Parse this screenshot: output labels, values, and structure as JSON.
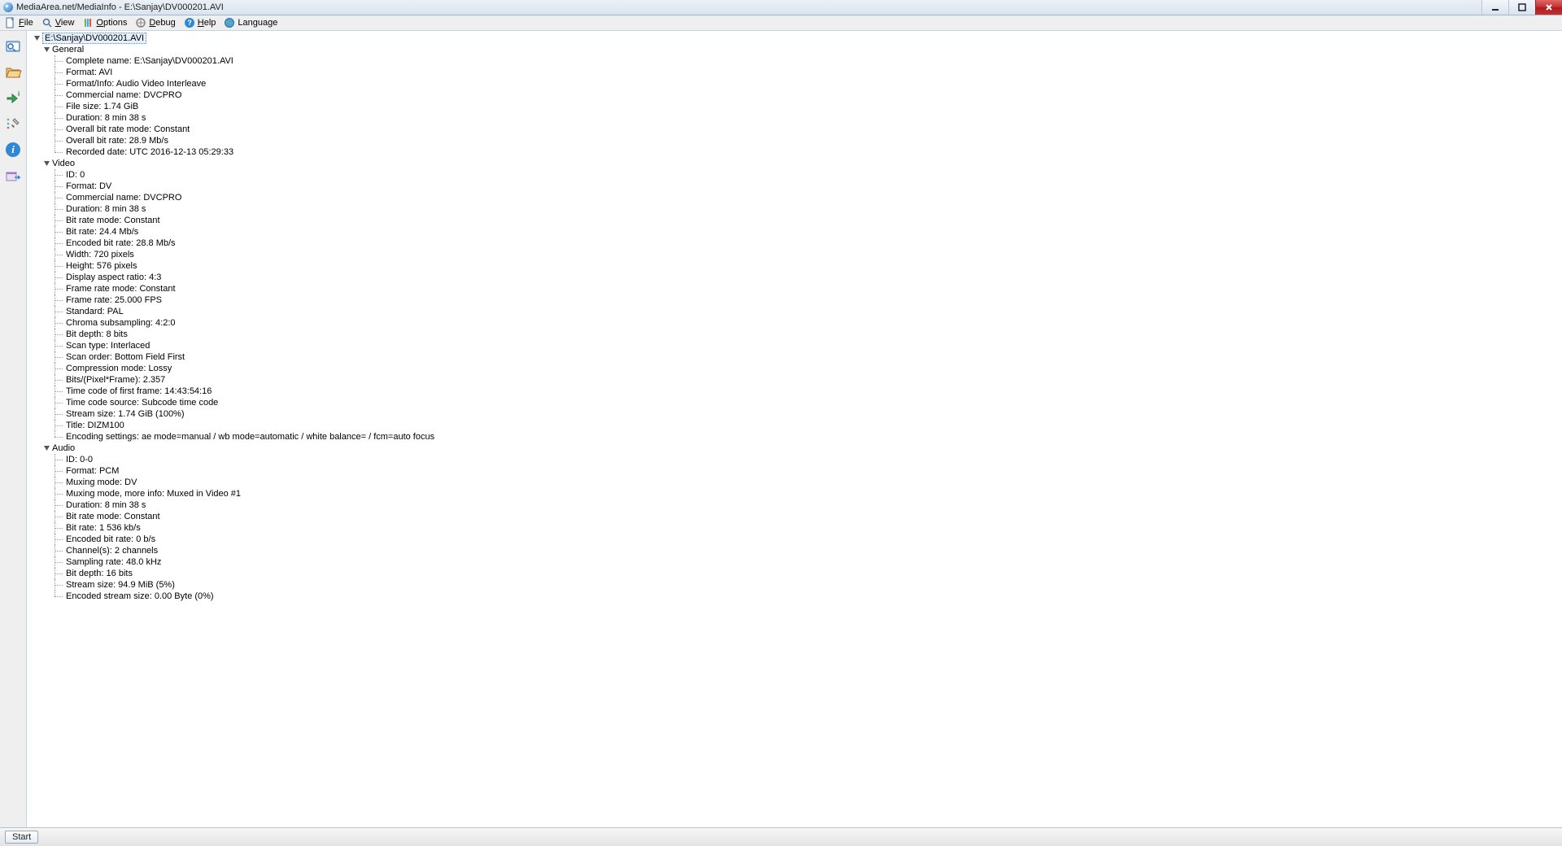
{
  "title": "MediaArea.net/MediaInfo - E:\\Sanjay\\DV000201.AVI",
  "menu": {
    "file": "File",
    "view": "View",
    "options": "Options",
    "debug": "Debug",
    "help": "Help",
    "language": "Language"
  },
  "taskbar": {
    "start": "Start"
  },
  "tree": {
    "root": "E:\\Sanjay\\DV000201.AVI",
    "general": {
      "label": "General",
      "items": [
        "Complete name: E:\\Sanjay\\DV000201.AVI",
        "Format: AVI",
        "Format/Info: Audio Video Interleave",
        "Commercial name: DVCPRO",
        "File size: 1.74 GiB",
        "Duration: 8 min 38 s",
        "Overall bit rate mode: Constant",
        "Overall bit rate: 28.9 Mb/s",
        "Recorded date: UTC 2016-12-13 05:29:33"
      ]
    },
    "video": {
      "label": "Video",
      "items": [
        "ID: 0",
        "Format: DV",
        "Commercial name: DVCPRO",
        "Duration: 8 min 38 s",
        "Bit rate mode: Constant",
        "Bit rate: 24.4 Mb/s",
        "Encoded bit rate: 28.8 Mb/s",
        "Width: 720 pixels",
        "Height: 576 pixels",
        "Display aspect ratio: 4:3",
        "Frame rate mode: Constant",
        "Frame rate: 25.000 FPS",
        "Standard: PAL",
        "Chroma subsampling: 4:2:0",
        "Bit depth: 8 bits",
        "Scan type: Interlaced",
        "Scan order: Bottom Field First",
        "Compression mode: Lossy",
        "Bits/(Pixel*Frame): 2.357",
        "Time code of first frame: 14:43:54:16",
        "Time code source: Subcode time code",
        "Stream size: 1.74 GiB (100%)",
        "Title: DIZM100",
        "Encoding settings: ae mode=manual / wb mode=automatic / white balance= / fcm=auto focus"
      ]
    },
    "audio": {
      "label": "Audio",
      "items": [
        "ID: 0-0",
        "Format: PCM",
        "Muxing mode: DV",
        "Muxing mode, more info: Muxed in Video #1",
        "Duration: 8 min 38 s",
        "Bit rate mode: Constant",
        "Bit rate: 1 536 kb/s",
        "Encoded bit rate: 0 b/s",
        "Channel(s): 2 channels",
        "Sampling rate: 48.0 kHz",
        "Bit depth: 16 bits",
        "Stream size: 94.9 MiB (5%)",
        "Encoded stream size: 0.00 Byte (0%)"
      ]
    }
  }
}
